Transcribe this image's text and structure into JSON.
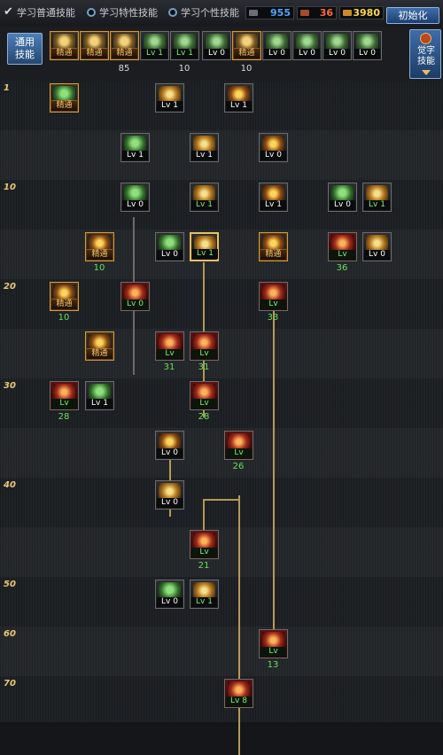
{
  "topbar": {
    "tab_common": "学习普通技能",
    "tab_special": "学习特性技能",
    "tab_personal": "学习个性技能",
    "stat1": "955",
    "stat2": "36",
    "stat3": "3980",
    "reset_button": "初始化"
  },
  "panel": {
    "common_skills_button": "通用\n技能",
    "side_button": "觉字\n技能",
    "slots": [
      {
        "label": "精通",
        "style": "mastery",
        "count": ""
      },
      {
        "label": "精通",
        "style": "mastery",
        "count": ""
      },
      {
        "label": "精通",
        "style": "mastery",
        "count": "85"
      },
      {
        "label": "Lv 1",
        "style": "green",
        "count": ""
      },
      {
        "label": "Lv 1",
        "style": "green",
        "count": "10"
      },
      {
        "label": "Lv 0",
        "style": "white",
        "count": ""
      },
      {
        "label": "精通",
        "style": "mastery",
        "count": "10"
      },
      {
        "label": "Lv 0",
        "style": "white",
        "count": ""
      },
      {
        "label": "Lv 0",
        "style": "white",
        "count": ""
      },
      {
        "label": "Lv 0",
        "style": "white",
        "count": ""
      },
      {
        "label": "Lv 0",
        "style": "white",
        "count": ""
      }
    ]
  },
  "levels": [
    "1",
    "10",
    "20",
    "30",
    "40",
    "50",
    "60",
    "70"
  ],
  "skills": [
    {
      "label": "精通",
      "count": ""
    },
    {
      "label": "Lv 1",
      "count": ""
    },
    {
      "label": "Lv 1",
      "count": ""
    },
    {
      "label": "Lv 1",
      "count": ""
    },
    {
      "label": "Lv 1",
      "count": ""
    },
    {
      "label": "Lv 0",
      "count": ""
    },
    {
      "label": "Lv 0",
      "count": ""
    },
    {
      "label": "Lv 1",
      "count": ""
    },
    {
      "label": "Lv 1",
      "count": ""
    },
    {
      "label": "Lv 0",
      "count": ""
    },
    {
      "label": "Lv 1",
      "count": ""
    },
    {
      "label": "精通",
      "count": "10"
    },
    {
      "label": "Lv 0",
      "count": ""
    },
    {
      "label": "Lv 1",
      "count": ""
    },
    {
      "label": "精通",
      "count": ""
    },
    {
      "label": "Lv",
      "count": "36"
    },
    {
      "label": "Lv 0",
      "count": ""
    },
    {
      "label": "精通",
      "count": "10"
    },
    {
      "label": "Lv 0",
      "count": ""
    },
    {
      "label": "Lv",
      "count": "33"
    },
    {
      "label": "精通",
      "count": ""
    },
    {
      "label": "Lv",
      "count": "31"
    },
    {
      "label": "Lv",
      "count": "31"
    },
    {
      "label": "Lv",
      "count": "28"
    },
    {
      "label": "Lv 1",
      "count": ""
    },
    {
      "label": "Lv",
      "count": "28"
    },
    {
      "label": "Lv 0",
      "count": ""
    },
    {
      "label": "Lv",
      "count": "26"
    },
    {
      "label": "Lv 0",
      "count": ""
    },
    {
      "label": "Lv",
      "count": "21"
    },
    {
      "label": "Lv 0",
      "count": ""
    },
    {
      "label": "Lv 1",
      "count": ""
    },
    {
      "label": "Lv",
      "count": "13"
    },
    {
      "label": "Lv 8",
      "count": ""
    }
  ]
}
